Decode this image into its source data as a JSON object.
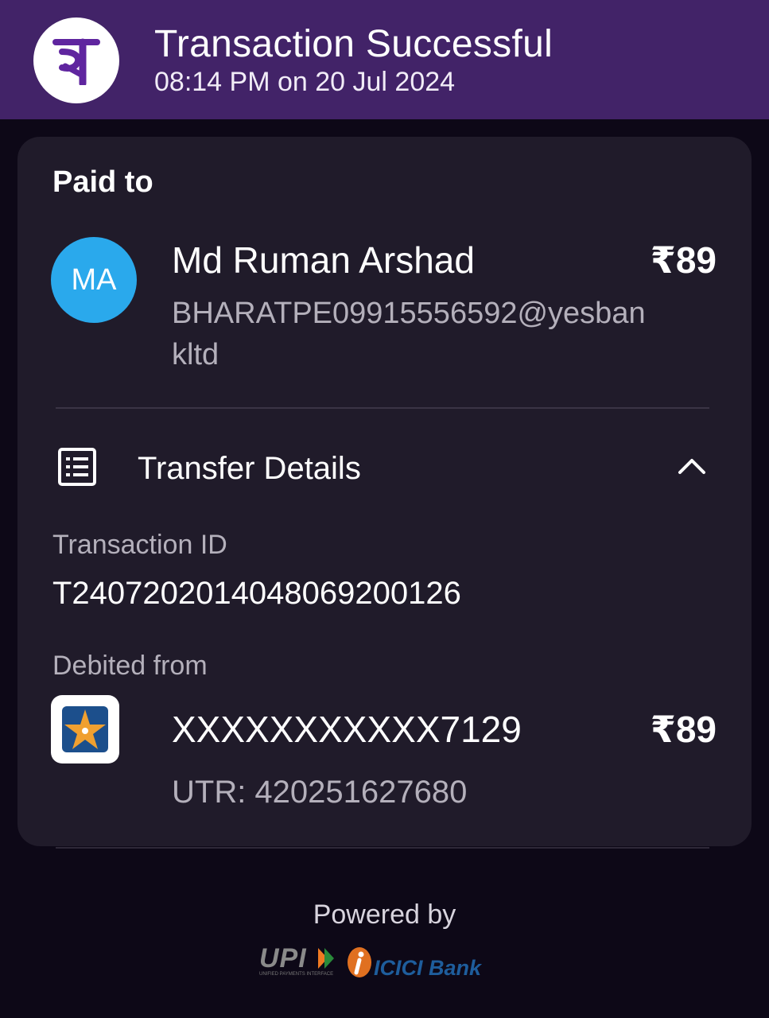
{
  "header": {
    "title": "Transaction Successful",
    "subtitle": "08:14 PM on 20 Jul 2024",
    "logo_glyph": "पे",
    "logo_icon": "phonepe-logo-icon",
    "background": "#422368"
  },
  "paid_to": {
    "label": "Paid to",
    "avatar_initials": "MA",
    "avatar_color": "#2aa9ec",
    "name": "Md Ruman Arshad",
    "amount": "₹89",
    "upi_id": "BHARATPE09915556592@yesbankltd"
  },
  "transfer_details": {
    "title": "Transfer Details",
    "icon": "receipt-list-icon",
    "toggle_icon": "chevron-up-icon",
    "transaction_id_label": "Transaction ID",
    "transaction_id": "T2407202014048069200126",
    "debited_from_label": "Debited from",
    "bank_icon": "bank-star-logo-icon",
    "account": "XXXXXXXXXXX7129",
    "amount": "₹89",
    "utr": "UTR: 420251627680"
  },
  "footer": {
    "powered_by": "Powered by",
    "upi_logo": "UPI",
    "upi_tagline": "UNIFIED PAYMENTS INTERFACE",
    "bank_logo": "ICICI Bank"
  }
}
